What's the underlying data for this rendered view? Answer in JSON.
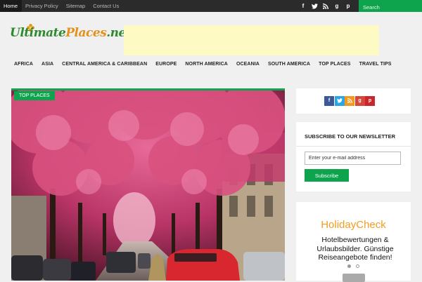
{
  "topnav": {
    "items": [
      {
        "label": "Home",
        "active": true
      },
      {
        "label": "Privacy Policy",
        "active": false
      },
      {
        "label": "Sitemap",
        "active": false
      },
      {
        "label": "Contact Us",
        "active": false
      }
    ]
  },
  "social_top": {
    "icons": [
      "facebook-icon",
      "twitter-icon",
      "rss-icon",
      "google-plus-icon",
      "pinterest-icon"
    ],
    "glyphs": [
      "f",
      "t",
      "◉",
      "g",
      "p"
    ]
  },
  "search": {
    "placeholder": "Search"
  },
  "logo": {
    "part1": "Ultimate",
    "part2": "Places",
    "part3": ".net"
  },
  "categories": [
    "AFRICA",
    "ASIA",
    "CENTRAL AMERICA & CARIBBEAN",
    "EUROPE",
    "NORTH AMERICA",
    "OCEANIA",
    "SOUTH AMERICA",
    "TOP PLACES",
    "TRAVEL TIPS"
  ],
  "hero": {
    "tag": "TOP PLACES"
  },
  "sidebar_social": {
    "icons": [
      {
        "name": "facebook-icon",
        "glyph": "f",
        "color": "#3b5998"
      },
      {
        "name": "twitter-icon",
        "glyph": "t",
        "color": "#2ba6e1"
      },
      {
        "name": "rss-icon",
        "glyph": "◉",
        "color": "#f29a1d"
      },
      {
        "name": "google-plus-icon",
        "glyph": "g",
        "color": "#d8463a"
      },
      {
        "name": "pinterest-icon",
        "glyph": "p",
        "color": "#c9262c"
      }
    ]
  },
  "newsletter": {
    "title": "SUBSCRIBE TO OUR NEWSLETTER",
    "email_placeholder": "Enter your e-mail address",
    "button_label": "Subscribe"
  },
  "ad": {
    "brand": "HolidayCheck",
    "text": "Hotelbewertungen & Urlaubsbilder. Günstige Reiseangebote finden!"
  },
  "colors": {
    "accent": "#0ea44d",
    "topbar": "#2b2b2b",
    "ad_yellow": "#fdfbc3",
    "brand_orange": "#f39c1f"
  }
}
